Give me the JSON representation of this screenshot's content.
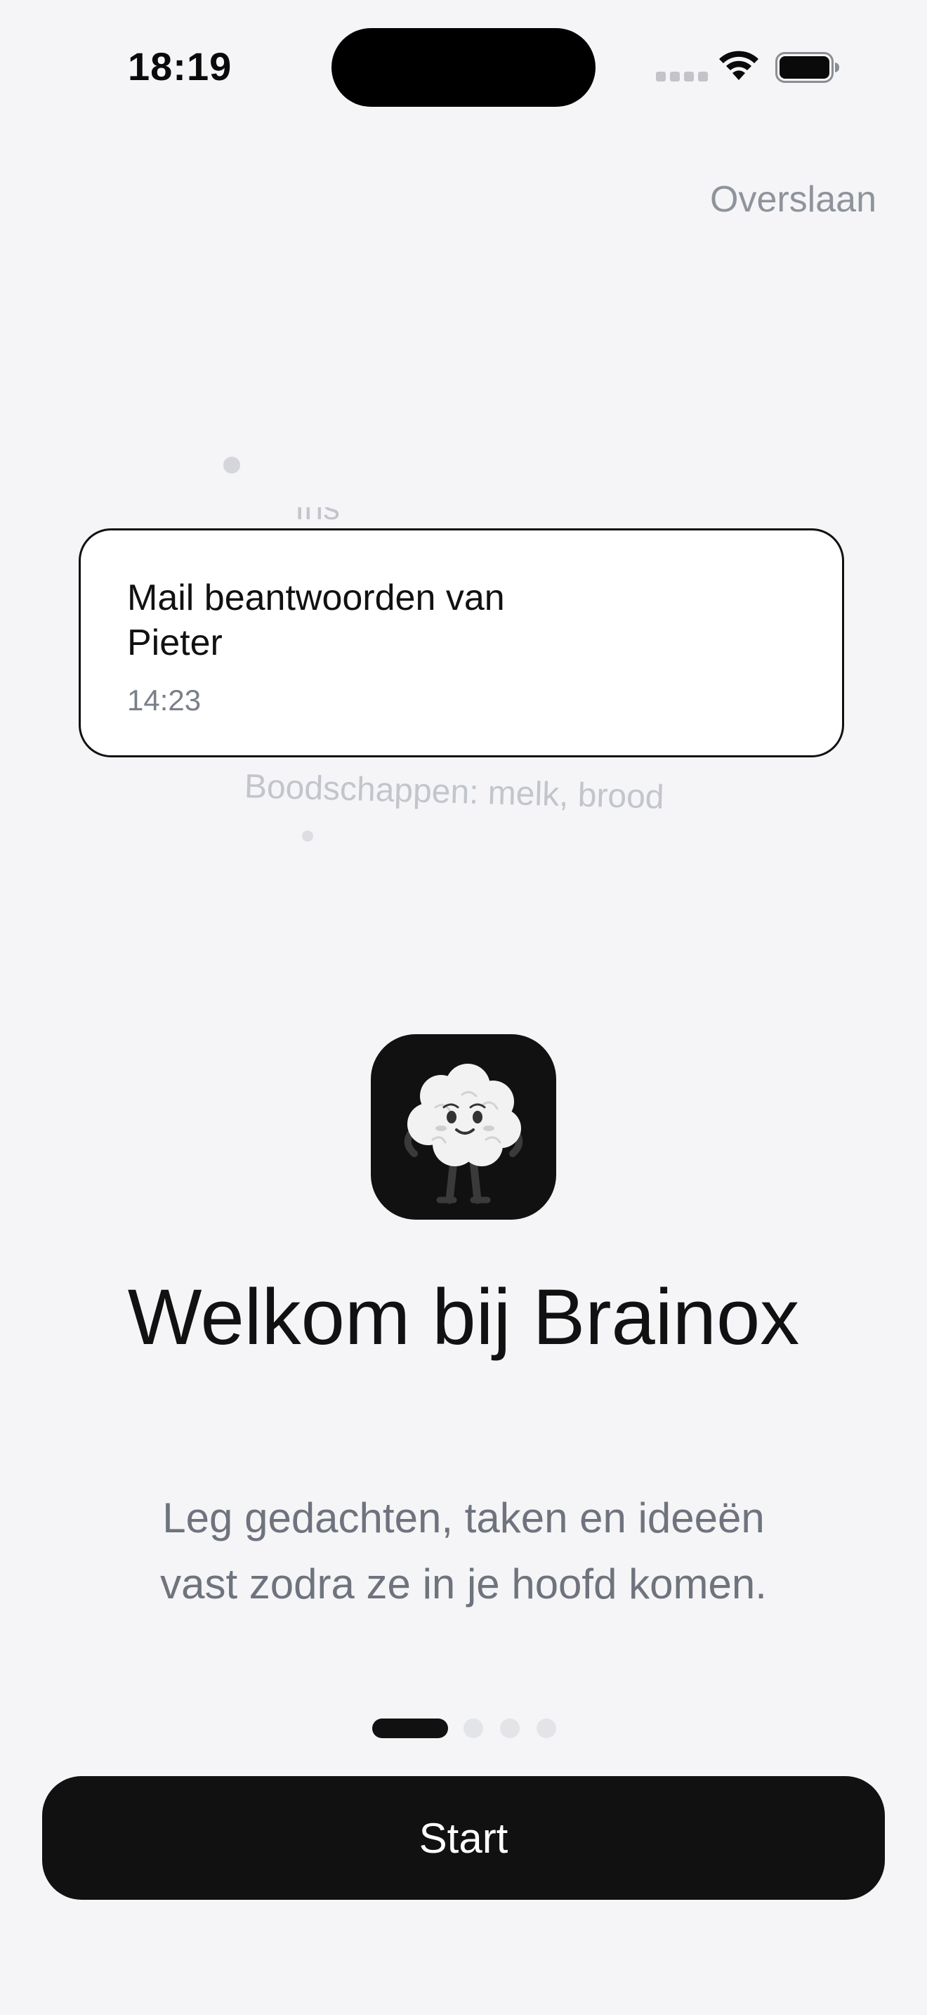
{
  "status_bar": {
    "time": "18:19",
    "wifi_icon": "wifi-icon",
    "battery_icon": "battery-icon"
  },
  "skip_label": "Overslaan",
  "floating_notes": {
    "faded_above": "Ins",
    "card": {
      "title": "Mail beantwoorden van Pieter",
      "time": "14:23"
    },
    "faded_below": "Boodschappen: melk, brood"
  },
  "app_icon": "brain-mascot-icon",
  "welcome": {
    "title": "Welkom bij Brainox",
    "subtitle": "Leg gedachten, taken en ideeën vast zodra ze in je hoofd komen."
  },
  "pager": {
    "total": 4,
    "active_index": 0
  },
  "start_label": "Start",
  "colors": {
    "background": "#f5f5f7",
    "primary": "#111111",
    "muted_text": "#6e737d",
    "skip_text": "#8f939c"
  }
}
